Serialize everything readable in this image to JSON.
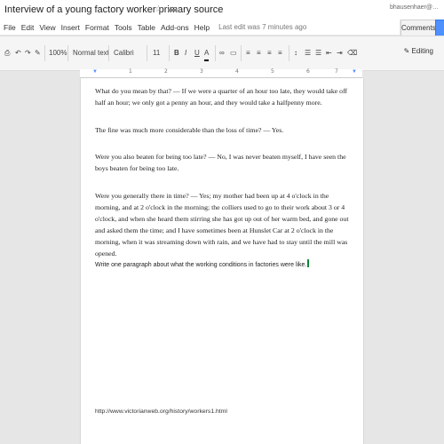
{
  "header": {
    "title": "Interview of a young factory worker primary source",
    "user_email": "bhausenhaer@…",
    "comments_label": "Comments"
  },
  "menu": {
    "items": [
      "File",
      "Edit",
      "View",
      "Insert",
      "Format",
      "Tools",
      "Table",
      "Add-ons",
      "Help"
    ],
    "last_edit": "Last edit was 7 minutes ago"
  },
  "toolbar": {
    "zoom": "100%",
    "style": "Normal text",
    "font": "Calibri",
    "size": "11",
    "bold": "B",
    "italic": "I",
    "underline": "U",
    "text_color": "A",
    "mode": "Editing"
  },
  "ruler": {
    "numbers": [
      "1",
      "2",
      "3",
      "4",
      "5",
      "6",
      "7"
    ]
  },
  "document": {
    "paragraphs": [
      "What do you mean by that? — If we were a quarter of an hour too late, they would take off half an hour; we only got a penny an hour, and they would take a halfpenny more.",
      "The fine was much more considerable than the loss of time? — Yes.",
      "Were you also beaten for being too late? — No, I was never beaten myself, I have seen the boys beaten for being too late.",
      "Were you generally there in time? — Yes; my mother had been up at 4 o'clock in the morning, and at 2 o'clock in the morning; the colliers used to go to their work about 3 or 4 o'clock, and when she heard them stirring she has got up out of her warm bed, and gone out and asked them the time; and I have sometimes been at Hunslet Car at 2 o'clock in the morning, when it was streaming down with rain, and we have had to stay until the mill was opened."
    ],
    "prompt": "Write one paragraph about what the working conditions in factories were like.",
    "source_url": "http://www.victorianweb.org/history/workers1.html"
  },
  "colors": {
    "share_blue": "#4d90fe",
    "cursor_green": "#0a8a3a"
  }
}
